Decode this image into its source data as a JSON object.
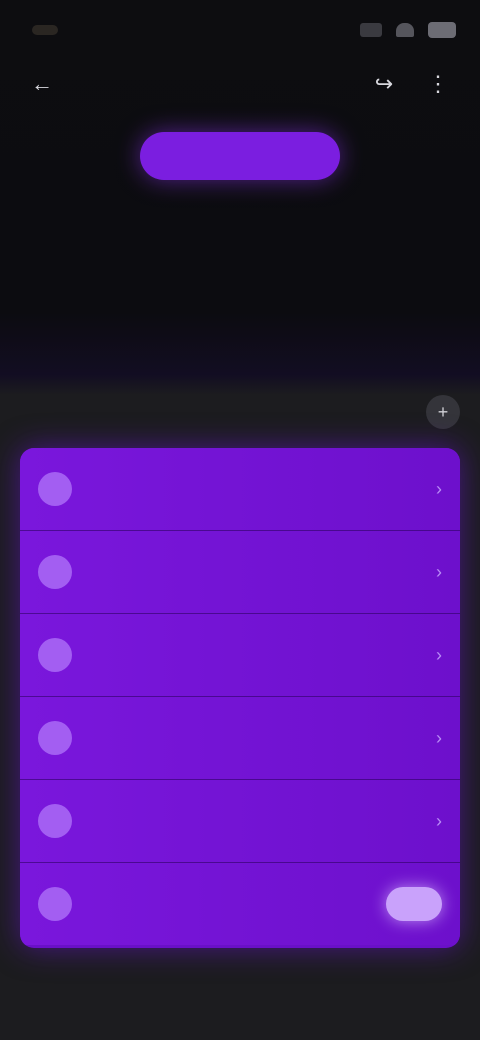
{
  "status_bar": {
    "time": "",
    "icons": [
      "signal-icon",
      "wifi-icon",
      "battery-icon"
    ]
  },
  "nav": {
    "title": "",
    "back_icon": "back-arrow-icon",
    "right_icons": [
      "share-icon",
      "more-icon"
    ]
  },
  "hero": {
    "pill_label": "",
    "heading": ""
  },
  "panel": {
    "label": "",
    "action_icon": "plus-icon",
    "items": [
      {
        "label": "",
        "icon": "circle-icon"
      },
      {
        "label": "",
        "icon": "circle-icon"
      },
      {
        "label": "",
        "icon": "circle-icon"
      },
      {
        "label": "",
        "icon": "circle-icon"
      },
      {
        "label": "",
        "icon": "circle-icon"
      },
      {
        "label": "",
        "icon": "circle-icon",
        "toggle": true
      }
    ]
  },
  "footer": {
    "link": ""
  },
  "colors": {
    "accent": "#7b1ee0",
    "panel": "#6a10c8",
    "background": "#0b0b0d"
  }
}
